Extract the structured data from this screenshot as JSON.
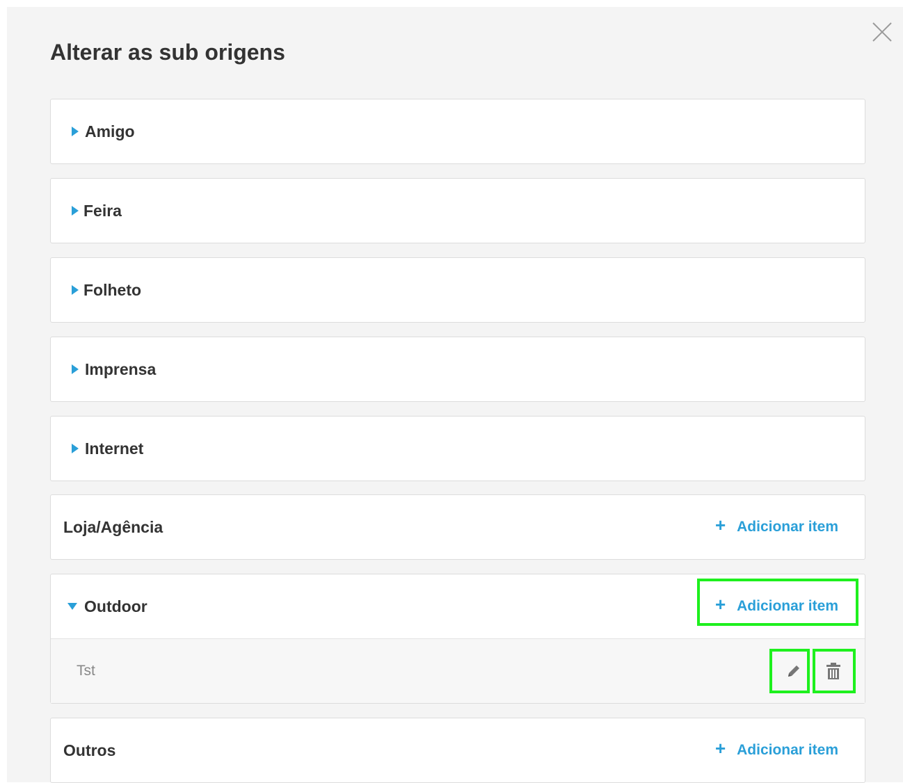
{
  "modal": {
    "title": "Alterar as sub origens",
    "close_icon": "close-icon"
  },
  "colors": {
    "accent": "#2a9fd8",
    "highlight": "#1ef01e",
    "background": "#f4f4f4",
    "panel": "#ffffff"
  },
  "origins": [
    {
      "label": "Amigo",
      "state": "collapsed"
    },
    {
      "label": "Feira",
      "state": "collapsed"
    },
    {
      "label": "Folheto",
      "state": "collapsed"
    },
    {
      "label": "Imprensa",
      "state": "collapsed"
    },
    {
      "label": "Internet",
      "state": "collapsed"
    },
    {
      "label": "Loja/Agência",
      "add_label": "Adicionar item"
    },
    {
      "label": "Outdoor",
      "state": "expanded",
      "add_label": "Adicionar item",
      "items": [
        {
          "label": "Tst",
          "edit_icon": "pencil-icon",
          "delete_icon": "trash-icon"
        }
      ]
    },
    {
      "label": "Outros",
      "add_label": "Adicionar item"
    }
  ]
}
